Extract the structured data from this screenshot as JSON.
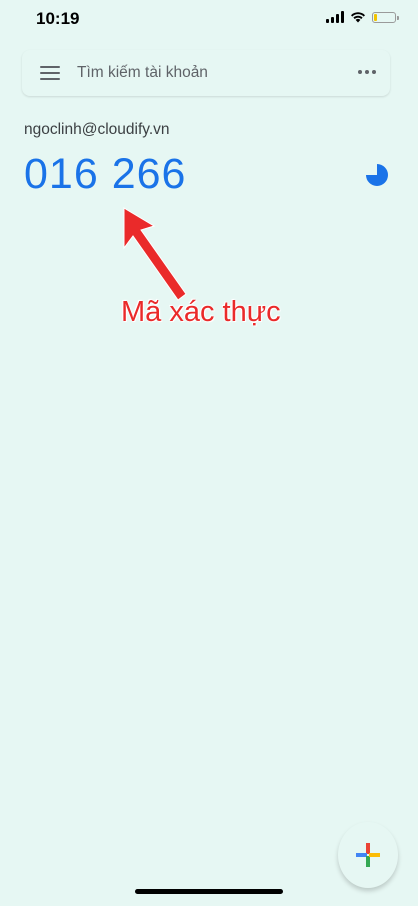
{
  "status_bar": {
    "time": "10:19",
    "battery_color": "#f2c400",
    "battery_level": 0.15
  },
  "search": {
    "placeholder": "Tìm kiếm tài khoản",
    "menu_icon": "hamburger-menu-icon",
    "more_icon": "more-horizontal-icon"
  },
  "account": {
    "email": "ngoclinh@cloudify.vn",
    "code": "016 266",
    "code_color": "#1a73e8",
    "timer_icon": "countdown-timer-icon",
    "timer_remaining_fraction": 0.75
  },
  "annotation": {
    "label": "Mã xác thực",
    "color": "#ea2a2a"
  },
  "fab": {
    "icon": "plus-icon",
    "colors": [
      "#ea4335",
      "#4285f4",
      "#34a853",
      "#fbbc05"
    ]
  }
}
